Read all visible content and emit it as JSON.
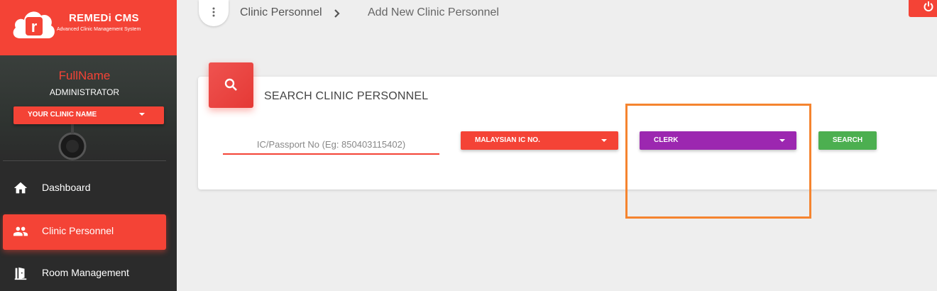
{
  "brand": {
    "title": "REMEDi CMS",
    "subtitle": "Advanced Clinic Management System",
    "color": "#f44336"
  },
  "user": {
    "fullname": "FullName",
    "role": "ADMINISTRATOR",
    "clinic_select": "YOUR CLINIC NAME"
  },
  "sidebar": {
    "items": [
      {
        "label": "Dashboard",
        "icon": "home-icon",
        "active": false
      },
      {
        "label": "Clinic Personnel",
        "icon": "people-icon",
        "active": true
      },
      {
        "label": "Room Management",
        "icon": "door-icon",
        "active": false
      }
    ]
  },
  "header": {
    "menu_icon": "vertical-dots-icon",
    "breadcrumb": [
      "Clinic Personnel",
      "Add New Clinic Personnel"
    ],
    "power_icon": "power-icon"
  },
  "card": {
    "title": "SEARCH CLINIC PERSONNEL",
    "icon": "search-icon",
    "ic_placeholder": "IC/Passport No (Eg: 850403115402)",
    "id_type_select": "MALAYSIAN IC NO.",
    "role_select": "CLERK",
    "search_button": "SEARCH"
  },
  "colors": {
    "accent": "#f44336",
    "role_select": "#9c27b0",
    "search_button": "#4caf50",
    "highlight_box": "#f5842f",
    "sidebar_bg": "#2b2b2b"
  }
}
